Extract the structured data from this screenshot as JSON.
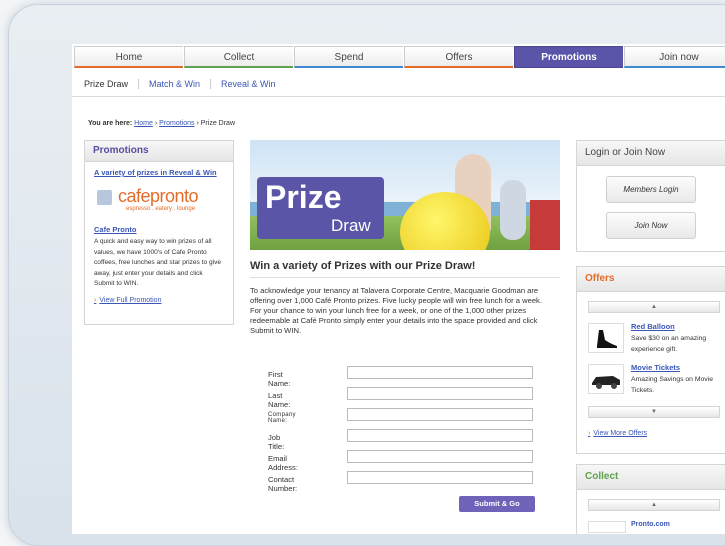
{
  "nav": {
    "tabs": [
      {
        "label": "Home",
        "active": false,
        "accent": "#e46c2a"
      },
      {
        "label": "Collect",
        "active": false,
        "accent": "#5ea14f"
      },
      {
        "label": "Spend",
        "active": false,
        "accent": "#3c8ad1"
      },
      {
        "label": "Offers",
        "active": false,
        "accent": "#e46c2a"
      },
      {
        "label": "Promotions",
        "active": true,
        "accent": "#5a55a8"
      },
      {
        "label": "Join now",
        "active": false,
        "accent": "#3c8ad1"
      }
    ]
  },
  "subnav": {
    "items": [
      "Prize Draw",
      "Match & Win",
      "Reveal & Win"
    ]
  },
  "breadcrumb": {
    "prefix": "You are here:",
    "items": [
      "Home",
      "Promotions",
      "Prize Draw"
    ],
    "separator": "›"
  },
  "left": {
    "heading": "Promotions",
    "promo_link": "A variety of prizes in Reveal & Win",
    "logo_word": "cafepronto",
    "logo_tag": "espresso . eatery . lounge",
    "cafe_title": "Cafe Pronto",
    "description": "A quick and easy way to win prizes of all values, we have 1000's of Cafe Pronto coffees, free lunches and star prizes to give away, just enter your details and click Submit to WIN.",
    "view_link": "View Full Promotion"
  },
  "hero": {
    "big": "Prize",
    "small": "Draw"
  },
  "main": {
    "title": "Win a variety of Prizes with our Prize Draw!",
    "para1": "To acknowledge your tenancy at Talavera Corporate Centre, Macquarie Goodman are offering over 1,000 Café Pronto prizes. Five lucky people will win free lunch for a week.",
    "para2": "For your chance to win your lunch free for a week, or one of the 1,000 other prizes redeemable at Café Pronto simply enter your details into the space provided and click Submit to WIN.",
    "fields": [
      {
        "label": "First Name:",
        "value": ""
      },
      {
        "label": "Last Name:",
        "value": ""
      },
      {
        "label": "Company Name:",
        "value": ""
      },
      {
        "label": "Job Title:",
        "value": ""
      },
      {
        "label": "Email Address:",
        "value": ""
      },
      {
        "label": "Contact Number:",
        "value": ""
      }
    ],
    "submit": "Submit & Go"
  },
  "login": {
    "heading": "Login or Join Now",
    "members": "Members Login",
    "join": "Join Now"
  },
  "offers": {
    "heading": "Offers",
    "up_icon": "arrow-up-icon",
    "items": [
      {
        "title": "Red Balloon",
        "desc": "Save $30 on an amazing experience gift.",
        "icon": "high-heel-icon"
      },
      {
        "title": "Movie Tickets",
        "desc": "Amazing Savings on Movie Tickets.",
        "icon": "car-icon"
      }
    ],
    "more": "View More Offers"
  },
  "collect": {
    "heading": "Collect",
    "peek": "Pronto.com"
  }
}
